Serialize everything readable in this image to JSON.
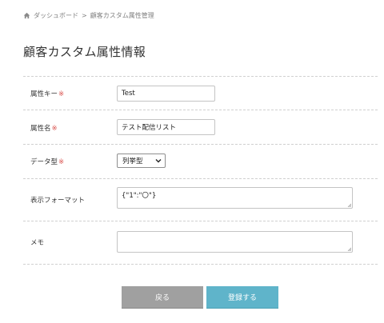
{
  "breadcrumb": {
    "home_icon": "home-icon",
    "dashboard_label": "ダッシュボード",
    "separator": ">",
    "current_label": "顧客カスタム属性管理"
  },
  "page": {
    "title": "顧客カスタム属性情報"
  },
  "form": {
    "required_mark": "※",
    "attribute_key": {
      "label": "属性キー",
      "value": "Test"
    },
    "attribute_name": {
      "label": "属性名",
      "value": "テスト配信リスト"
    },
    "data_type": {
      "label": "データ型",
      "selected": "列挙型"
    },
    "display_format": {
      "label": "表示フォーマット",
      "value": "{\"1\":\"〇\"}"
    },
    "memo": {
      "label": "メモ",
      "value": ""
    }
  },
  "buttons": {
    "back_label": "戻る",
    "submit_label": "登録する"
  },
  "colors": {
    "required": "#d9534f",
    "back_button": "#a0a0a0",
    "submit_button": "#5fb4ca"
  }
}
